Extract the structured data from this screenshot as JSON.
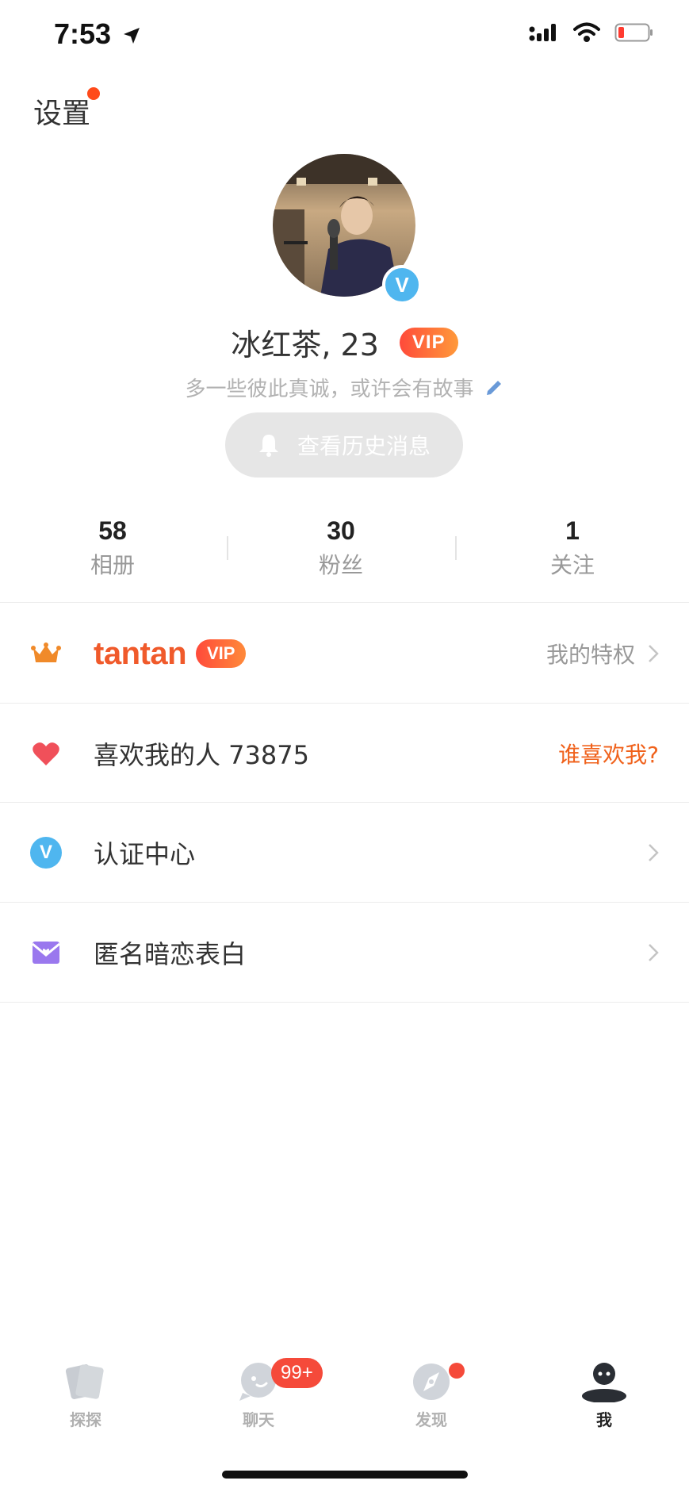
{
  "status_bar": {
    "time": "7:53",
    "icons": [
      "location-arrow-icon",
      "signal-icon",
      "wifi-icon",
      "battery-icon"
    ]
  },
  "header": {
    "settings_label": "设置",
    "settings_dot_color": "#ff4a1a"
  },
  "profile": {
    "name_age": "冰红茶, 23",
    "vip_badge": "VIP",
    "bio": "多一些彼此真诚，或许会有故事",
    "history_button": "查看历史消息",
    "verify_badge": "V"
  },
  "stats": [
    {
      "value": "58",
      "label": "相册"
    },
    {
      "value": "30",
      "label": "粉丝"
    },
    {
      "value": "1",
      "label": "关注"
    }
  ],
  "menu": {
    "vip_row": {
      "brand": "tantan",
      "badge": "VIP",
      "right_label": "我的特权"
    },
    "likes_row": {
      "label": "喜欢我的人 73875",
      "right_label": "谁喜欢我?"
    },
    "verify_row": {
      "label": "认证中心",
      "icon_letter": "V"
    },
    "crush_row": {
      "label": "匿名暗恋表白"
    }
  },
  "tabbar": {
    "tabs": [
      {
        "label": "探探",
        "icon": "cards-icon",
        "active": false
      },
      {
        "label": "聊天",
        "icon": "chat-icon",
        "active": false
      },
      {
        "label": "发现",
        "icon": "compass-icon",
        "active": false
      },
      {
        "label": "我",
        "icon": "profile-icon",
        "active": true
      }
    ],
    "chat_badge": "99+"
  },
  "colors": {
    "accent": "#f05a2b",
    "vip_gradient_start": "#ff4a3a",
    "vip_gradient_end": "#ff9a3a",
    "verify_blue": "#4fb6ef",
    "crush_purple": "#9a78ee",
    "heart_red": "#f0505a"
  }
}
